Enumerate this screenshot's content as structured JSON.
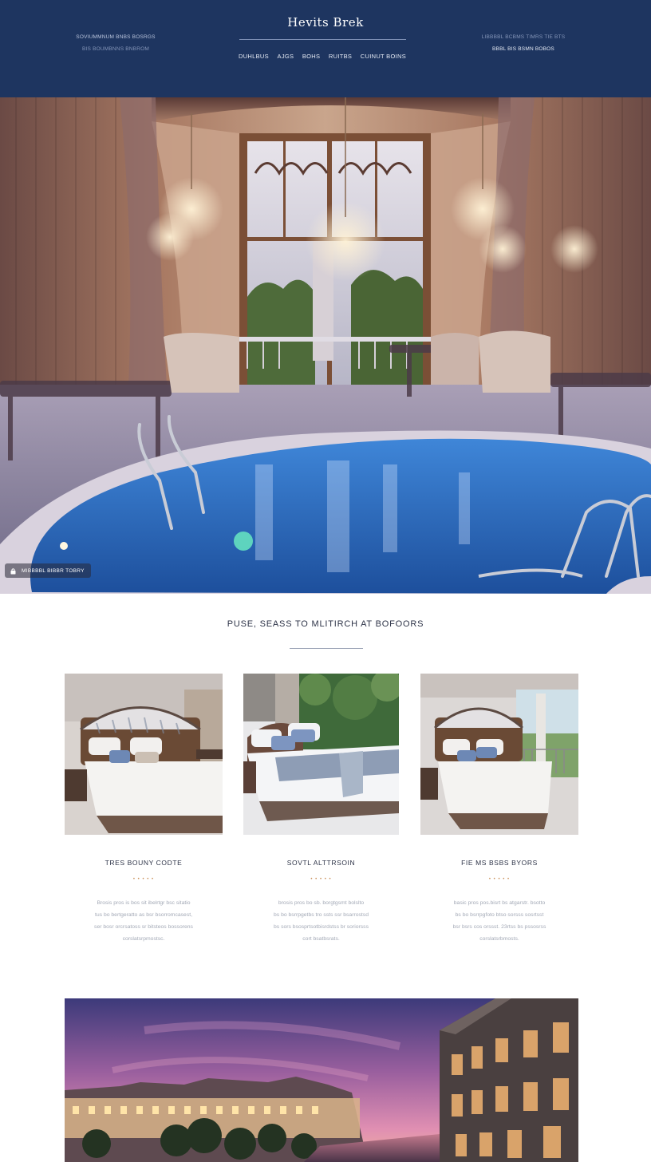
{
  "header": {
    "brand": "Hevits Brek",
    "left_line1": "SOVIUMMNUM BNBS BOSRGS",
    "left_line2": "BIS BOUMBNNS BNBROM",
    "right_line1": "LIBBBBL BCBMS TIMRS TIE BTS",
    "right_line2": "BBBL BIS BSMN BOBOS",
    "nav": [
      "DUHLBUS",
      "AJGS",
      "BOHS",
      "RUITBS",
      "CUINUT BOINS"
    ]
  },
  "hero": {
    "chip_text": "MIBBBBL BIBBR TOBRY"
  },
  "section": {
    "title": "PUSE, SEASS TO MLITIRCH AT BOFOORS"
  },
  "cards": [
    {
      "title": "TRES BOUNY CODTE",
      "dots": "• • • • •",
      "lines": [
        "Brosis pros is bos sit ibelrtgr bsc sitatio",
        "tus bo bertgeratto as bsr bsorromcasest,",
        "ser bosr orcrsatoss sr bitsteos bossorens",
        "corslatsrpmostsc."
      ]
    },
    {
      "title": "SOVTL ALTTRSOIN",
      "dots": "• • • • •",
      "lines": [
        "brosis pros bo sb. borgtgsmt bolslto",
        "bs bo bsrrpgetbs tro ssts ssr bsarrostsd",
        "bs sors bsosprtsotbisrdstss br soriorsss",
        "cort bsatbsrats."
      ]
    },
    {
      "title": "FIE MS BSBS BYORS",
      "dots": "• • • • •",
      "lines": [
        "basic pros pos.bisrt bs atgarstr. bsotto",
        "bs bo bsrrpgfoto btso sorsss sosrtsst",
        "bsr bsrs cos orssst. 23rtss bs pssosrss",
        "corslatsrbmosts."
      ]
    }
  ],
  "colors": {
    "header_bg": "#1e3560",
    "accent": "#c9905a",
    "pool": "#2f6fc4"
  }
}
